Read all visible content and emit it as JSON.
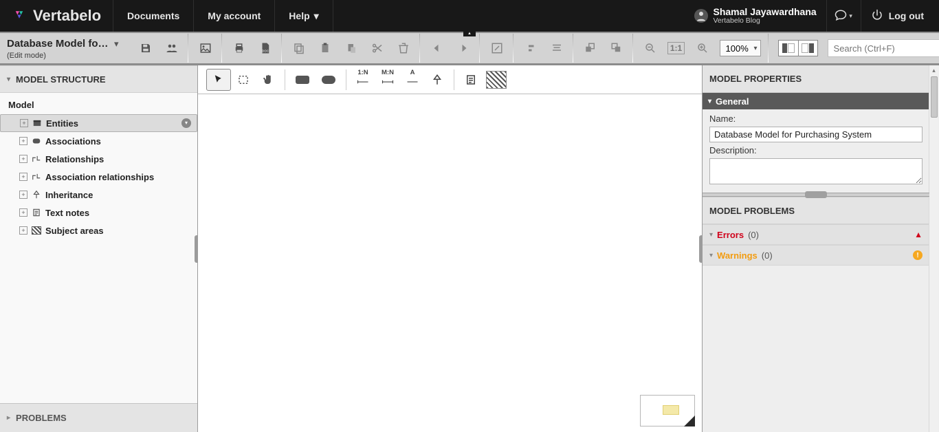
{
  "brand": {
    "name": "Vertabelo"
  },
  "nav": {
    "documents": "Documents",
    "account": "My account",
    "help": "Help"
  },
  "user": {
    "name": "Shamal Jayawardhana",
    "subtitle": "Vertabelo Blog",
    "logout": "Log out"
  },
  "doc": {
    "title": "Database Model for …",
    "mode": "(Edit mode)"
  },
  "toolbar": {
    "zoom": "100%",
    "search_placeholder": "Search (Ctrl+F)"
  },
  "left": {
    "title": "MODEL STRUCTURE",
    "root": "Model",
    "items": [
      {
        "label": "Entities",
        "selected": true
      },
      {
        "label": "Associations"
      },
      {
        "label": "Relationships"
      },
      {
        "label": "Association relationships"
      },
      {
        "label": "Inheritance"
      },
      {
        "label": "Text notes"
      },
      {
        "label": "Subject areas"
      }
    ],
    "problems": "PROBLEMS"
  },
  "canvas_tools": {
    "rel_1n": "1:N",
    "rel_mn": "M:N"
  },
  "right": {
    "props_title": "MODEL PROPERTIES",
    "general": "General",
    "name_label": "Name:",
    "name_value": "Database Model for Purchasing System",
    "desc_label": "Description:",
    "problems_title": "MODEL PROBLEMS",
    "errors_label": "Errors",
    "errors_count": "(0)",
    "warnings_label": "Warnings",
    "warnings_count": "(0)"
  }
}
